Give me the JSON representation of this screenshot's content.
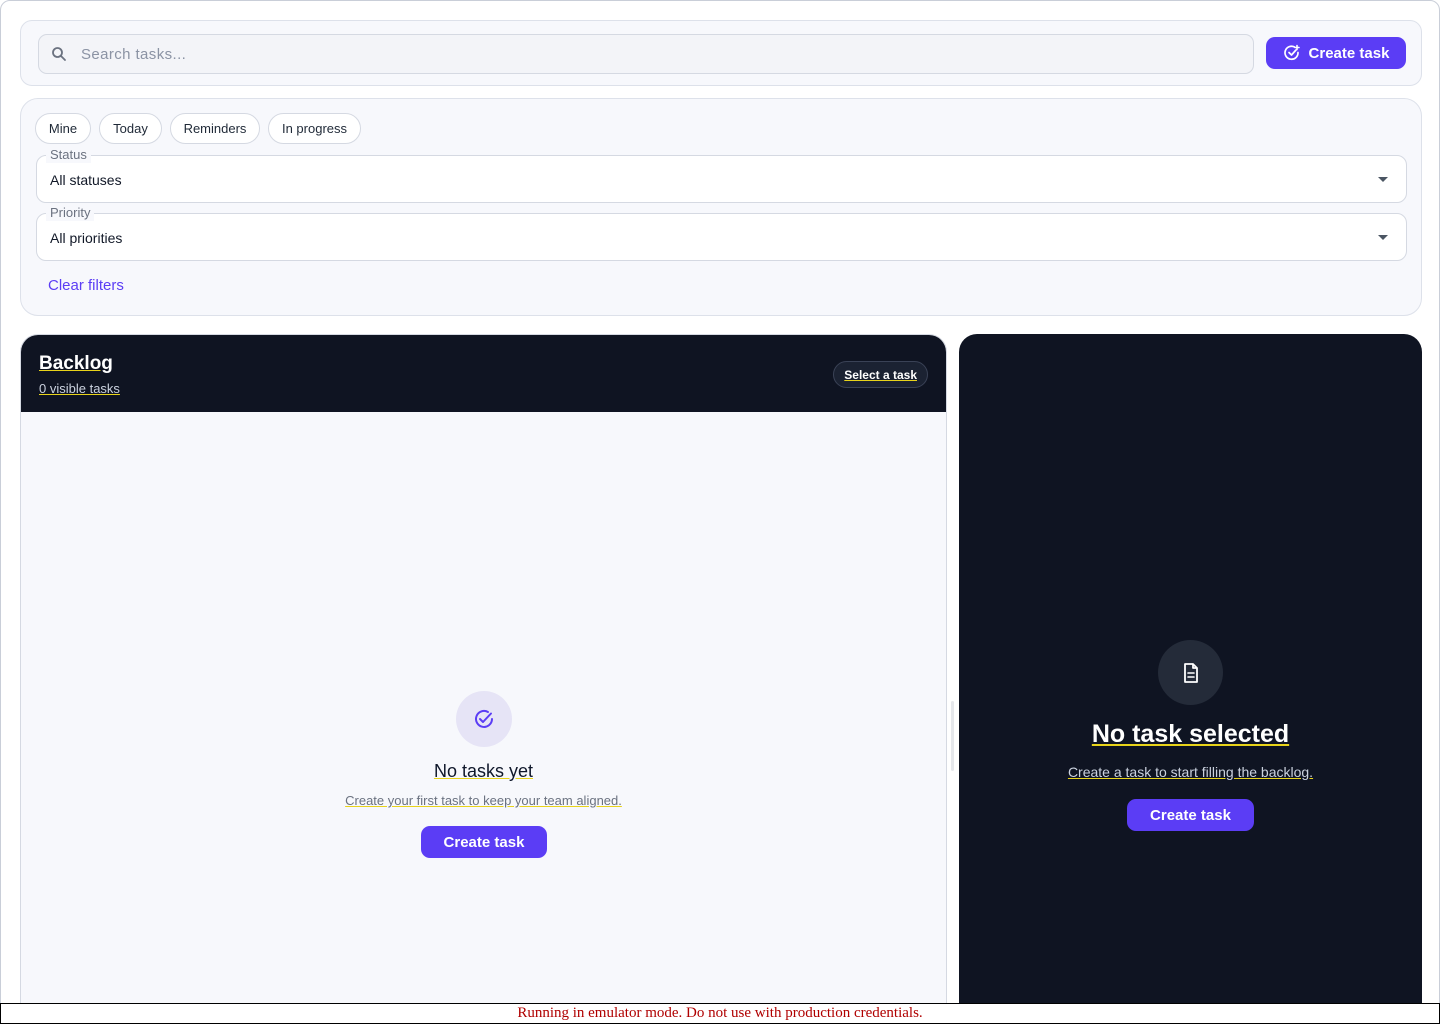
{
  "search": {
    "placeholder": "Search tasks...",
    "value": "",
    "icon": "search-icon",
    "create_label": "Create task"
  },
  "filters": {
    "chips": [
      "Mine",
      "Today",
      "Reminders",
      "In progress"
    ],
    "status": {
      "label": "Status",
      "value": "All statuses"
    },
    "priority": {
      "label": "Priority",
      "value": "All priorities"
    },
    "clear_label": "Clear filters"
  },
  "backlog": {
    "title": "Backlog",
    "count_text": "0 visible tasks",
    "select_pill": "Select a task",
    "empty_title": "No tasks yet",
    "empty_subtitle": "Create your first task to keep your team aligned.",
    "create_label": "Create task"
  },
  "detail": {
    "title": "No task selected",
    "subtitle": "Create a task to start filling the backlog.",
    "create_label": "Create task"
  },
  "banner": {
    "text": "Running in emulator mode. Do not use with production credentials."
  },
  "colors": {
    "accent": "#5b3df5",
    "dark_panel": "#0f1422",
    "banner_text": "#b00000"
  }
}
